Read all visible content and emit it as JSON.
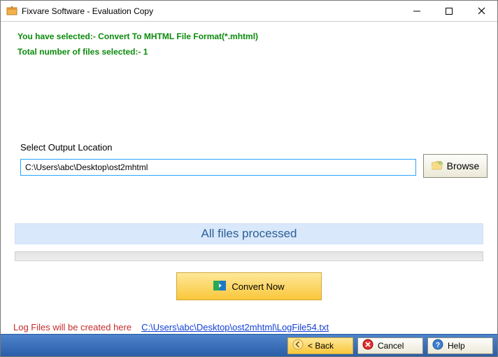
{
  "titlebar": {
    "title": "Fixvare Software - Evaluation Copy"
  },
  "messages": {
    "selected_format": "You have selected:- Convert To MHTML File Format(*.mhtml)",
    "file_count": "Total number of files selected:- 1"
  },
  "output": {
    "label": "Select Output Location",
    "path": "C:\\Users\\abc\\Desktop\\ost2mhtml",
    "browse_label": "Browse"
  },
  "status": {
    "text": "All files processed"
  },
  "convert": {
    "label": "Convert Now"
  },
  "log": {
    "label": "Log Files will be created here",
    "path": "C:\\Users\\abc\\Desktop\\ost2mhtml\\LogFile54.txt"
  },
  "buttons": {
    "back": "< Back",
    "cancel": "Cancel",
    "help": "Help"
  }
}
